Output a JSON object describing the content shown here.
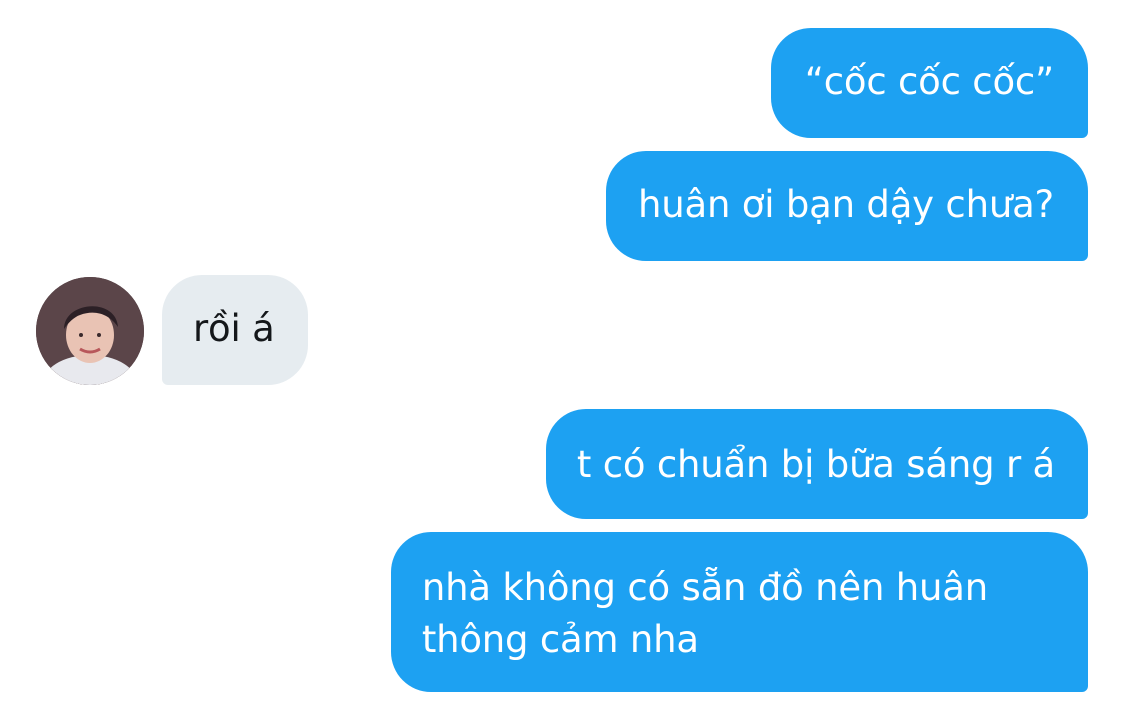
{
  "conversation": {
    "messages": [
      {
        "sender": "me",
        "text": "“cốc cốc cốc”"
      },
      {
        "sender": "me",
        "text": "huân ơi bạn dậy chưa?"
      },
      {
        "sender": "them",
        "text": "rồi á"
      },
      {
        "sender": "me",
        "text": "t có chuẩn bị bữa sáng r á"
      },
      {
        "sender": "me",
        "lines": [
          "nhà không có sẵn đồ nên huân",
          "thông cảm nha"
        ]
      }
    ],
    "avatar_icon": "user-photo-avatar"
  },
  "colors": {
    "outgoing_bubble": "#1da1f2",
    "incoming_bubble": "#e6ecf0",
    "outgoing_text": "#ffffff",
    "incoming_text": "#14171a"
  }
}
